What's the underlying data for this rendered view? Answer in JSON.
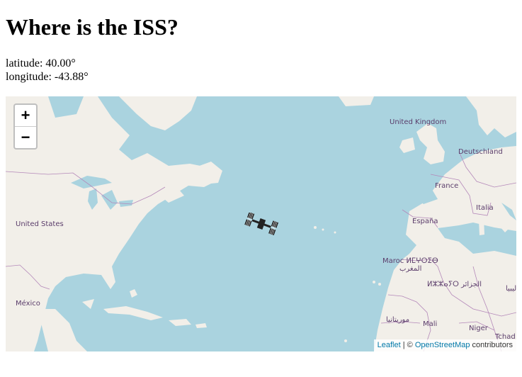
{
  "page": {
    "title": "Where is the ISS?",
    "latitude_text": "latitude: 40.00°",
    "longitude_text": "longitude: -43.88°"
  },
  "map": {
    "zoom_in_label": "+",
    "zoom_out_label": "−",
    "marker_icon": "iss-icon",
    "labels": {
      "united_kingdom": "United Kingdom",
      "deutschland": "Deutschland",
      "france": "France",
      "italia": "Italia",
      "espana": "España",
      "united_states": "United States",
      "maroc": "Maroc ⵍⵎⵖⵔⵉⴱ",
      "maroc_ar": "المغرب",
      "algerie": "ⵍⵣⵣⴰⵢⵔ الجزائر",
      "libya": "ليبيا",
      "mexico": "México",
      "mauritania": "موريتانيا",
      "mali": "Mali",
      "niger": "Niger",
      "tchad": "Tchad"
    },
    "attribution": {
      "leaflet": "Leaflet",
      "separator": " | © ",
      "osm": "OpenStreetMap",
      "contributors": " contributors"
    }
  }
}
